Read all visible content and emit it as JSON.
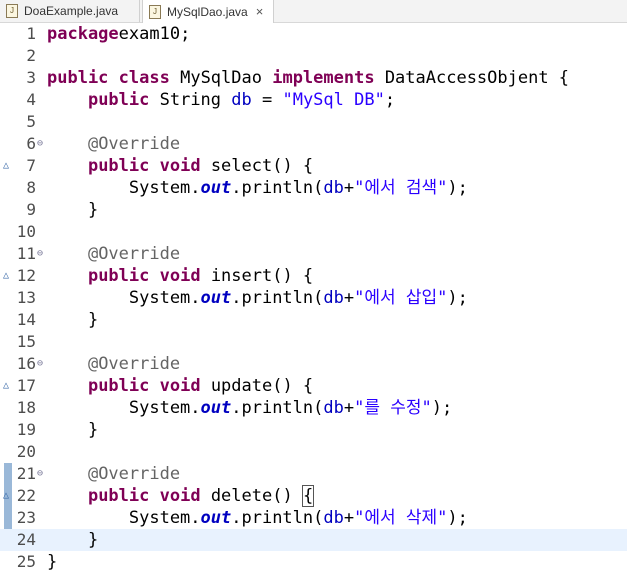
{
  "tabs": [
    {
      "label": "DoaExample.java",
      "icon": "java-file-icon",
      "active": false
    },
    {
      "label": "MySqlDao.java",
      "icon": "java-file-icon",
      "active": true,
      "close": "×"
    }
  ],
  "editor": {
    "lines": [
      {
        "n": "1",
        "tokens": [
          [
            "kw",
            "package"
          ],
          [
            "",
            "exam10;"
          ]
        ]
      },
      {
        "n": "2",
        "tokens": []
      },
      {
        "n": "3",
        "tokens": [
          [
            "kw",
            "public"
          ],
          [
            "",
            " "
          ],
          [
            "kw",
            "class"
          ],
          [
            "",
            " MySqlDao "
          ],
          [
            "kw",
            "implements"
          ],
          [
            "",
            " DataAccessObjent {"
          ]
        ]
      },
      {
        "n": "4",
        "tokens": [
          [
            "",
            "    "
          ],
          [
            "kw",
            "public"
          ],
          [
            "",
            " String "
          ],
          [
            "field",
            "db"
          ],
          [
            "",
            " = "
          ],
          [
            "str",
            "\"MySql DB\""
          ],
          [
            "",
            ";"
          ]
        ]
      },
      {
        "n": "5",
        "tokens": []
      },
      {
        "n": "6",
        "fold": "⊖",
        "tokens": [
          [
            "",
            "    "
          ],
          [
            "ann",
            "@Override"
          ]
        ]
      },
      {
        "n": "7",
        "override": "△",
        "tokens": [
          [
            "",
            "    "
          ],
          [
            "kw",
            "public"
          ],
          [
            "",
            " "
          ],
          [
            "kw",
            "void"
          ],
          [
            "",
            " select() {"
          ]
        ]
      },
      {
        "n": "8",
        "tokens": [
          [
            "",
            "        System."
          ],
          [
            "sfield",
            "out"
          ],
          [
            "",
            ".println("
          ],
          [
            "field",
            "db"
          ],
          [
            "",
            "+"
          ],
          [
            "str",
            "\"에서 검색\""
          ],
          [
            "",
            ");"
          ]
        ]
      },
      {
        "n": "9",
        "tokens": [
          [
            "",
            "    }"
          ]
        ]
      },
      {
        "n": "10",
        "tokens": []
      },
      {
        "n": "11",
        "fold": "⊖",
        "tokens": [
          [
            "",
            "    "
          ],
          [
            "ann",
            "@Override"
          ]
        ]
      },
      {
        "n": "12",
        "override": "△",
        "tokens": [
          [
            "",
            "    "
          ],
          [
            "kw",
            "public"
          ],
          [
            "",
            " "
          ],
          [
            "kw",
            "void"
          ],
          [
            "",
            " insert() {"
          ]
        ]
      },
      {
        "n": "13",
        "tokens": [
          [
            "",
            "        System."
          ],
          [
            "sfield",
            "out"
          ],
          [
            "",
            ".println("
          ],
          [
            "field",
            "db"
          ],
          [
            "",
            "+"
          ],
          [
            "str",
            "\"에서 삽입\""
          ],
          [
            "",
            ");"
          ]
        ]
      },
      {
        "n": "14",
        "tokens": [
          [
            "",
            "    }"
          ]
        ]
      },
      {
        "n": "15",
        "tokens": []
      },
      {
        "n": "16",
        "fold": "⊖",
        "tokens": [
          [
            "",
            "    "
          ],
          [
            "ann",
            "@Override"
          ]
        ]
      },
      {
        "n": "17",
        "override": "△",
        "tokens": [
          [
            "",
            "    "
          ],
          [
            "kw",
            "public"
          ],
          [
            "",
            " "
          ],
          [
            "kw",
            "void"
          ],
          [
            "",
            " update() {"
          ]
        ]
      },
      {
        "n": "18",
        "tokens": [
          [
            "",
            "        System."
          ],
          [
            "sfield",
            "out"
          ],
          [
            "",
            ".println("
          ],
          [
            "field",
            "db"
          ],
          [
            "",
            "+"
          ],
          [
            "str",
            "\"를 수정\""
          ],
          [
            "",
            ");"
          ]
        ]
      },
      {
        "n": "19",
        "tokens": [
          [
            "",
            "    }"
          ]
        ]
      },
      {
        "n": "20",
        "tokens": []
      },
      {
        "n": "21",
        "fold": "⊖",
        "tokens": [
          [
            "",
            "    "
          ],
          [
            "ann",
            "@Override"
          ]
        ]
      },
      {
        "n": "22",
        "override": "△",
        "tokens": [
          [
            "",
            "    "
          ],
          [
            "kw",
            "public"
          ],
          [
            "",
            " "
          ],
          [
            "kw",
            "void"
          ],
          [
            "",
            " delete() "
          ],
          [
            "bracket",
            "{"
          ]
        ]
      },
      {
        "n": "23",
        "tokens": [
          [
            "",
            "        System."
          ],
          [
            "sfield",
            "out"
          ],
          [
            "",
            ".println("
          ],
          [
            "field",
            "db"
          ],
          [
            "",
            "+"
          ],
          [
            "str",
            "\"에서 삭제\""
          ],
          [
            "",
            ");"
          ]
        ]
      },
      {
        "n": "24",
        "current": true,
        "tokens": [
          [
            "",
            "    }"
          ]
        ]
      },
      {
        "n": "25",
        "tokens": [
          [
            "",
            "}"
          ]
        ]
      }
    ]
  },
  "colors": {
    "keyword": "#7f0055",
    "string": "#2a00ff",
    "annotation": "#646464",
    "field": "#0000c0",
    "current_line": "#e8f2fe"
  }
}
